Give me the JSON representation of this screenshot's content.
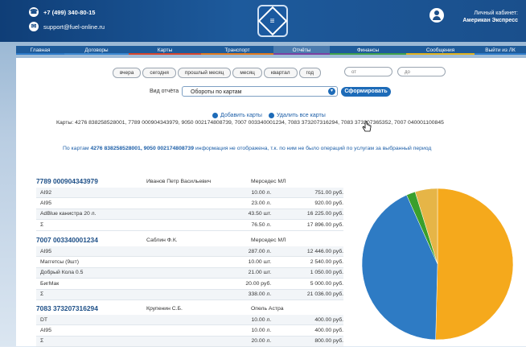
{
  "header": {
    "phone": "+7 (499) 340-80-15",
    "email": "support@fuel-online.ru",
    "logo_glyph": "≡",
    "account_label": "Личный кабинет:",
    "account_name": "Американ Экспресс"
  },
  "nav": {
    "items": [
      {
        "label": "Главная",
        "underline": "#2d7ac8"
      },
      {
        "label": "Договоры",
        "underline": "#3a86cf"
      },
      {
        "label": "Карты",
        "underline": "#d6452d"
      },
      {
        "label": "Транспорт",
        "underline": "#e17a1e"
      },
      {
        "label": "Отчёты",
        "underline": "#7a3fa0",
        "active": true
      },
      {
        "label": "Финансы",
        "underline": "#3fa04a"
      },
      {
        "label": "Сообщения",
        "underline": "#e0b21e"
      },
      {
        "label": "Выйти из ЛК",
        "underline": "#2d7ac8"
      }
    ]
  },
  "period_buttons": [
    "вчера",
    "сегодня",
    "прошлый месяц",
    "месяц",
    "квартал",
    "год"
  ],
  "date_from_placeholder": "от",
  "date_to_placeholder": "до",
  "report_type_label": "Вид отчёта",
  "report_type_value": "Обороты по картам",
  "generate_button": "Сформировать",
  "add_cards_link": "Добавить карты",
  "remove_cards_link": "Удалить все карты",
  "cards_line": "Карты: 4276 838258528001, 7789 000904343979, 9050 002174808739, 7007 003340001234, 7083 373207316294, 7083 373207365352, 7007 040001100845",
  "info": {
    "prefix": "По картам",
    "cards": "4276 838258528001, 9050 002174808739",
    "suffix": "информация не отображена, т.к. по ним не было операций по услугам за выбранный период"
  },
  "groups": [
    {
      "card": "7789 000904343979",
      "owner": "Иванов Петр Васильевич",
      "car": "Мерседес МЛ",
      "rows": [
        {
          "item": "AI92",
          "qty": "10.00 л.",
          "amount": "751.00 руб."
        },
        {
          "item": "AI95",
          "qty": "23.00 л.",
          "amount": "920.00 руб."
        },
        {
          "item": "AdBlue канистра 20 л.",
          "qty": "43.50 шт.",
          "amount": "16 225.00 руб."
        },
        {
          "item": "Σ",
          "qty": "76.50 л.",
          "amount": "17 896.00 руб."
        }
      ]
    },
    {
      "card": "7007 003340001234",
      "owner": "Саблин Ф.К.",
      "car": "Мерседес МЛ",
      "rows": [
        {
          "item": "AI95",
          "qty": "287.00 л.",
          "amount": "12 446.00 руб."
        },
        {
          "item": "Маггетсы (9шт)",
          "qty": "10.00 шт.",
          "amount": "2 540.00 руб."
        },
        {
          "item": "Добрый Кола 0.5",
          "qty": "21.00 шт.",
          "amount": "1 050.00 руб."
        },
        {
          "item": "БигМак",
          "qty": "20.00 руб.",
          "amount": "5 000.00 руб."
        },
        {
          "item": "Σ",
          "qty": "338.00 л.",
          "amount": "21 036.00 руб."
        }
      ]
    },
    {
      "card": "7083 373207316294",
      "owner": "Крупенин С.Б.",
      "car": "Опель Астра",
      "rows": [
        {
          "item": "DT",
          "qty": "10.00 л.",
          "amount": "400.00 руб."
        },
        {
          "item": "AI95",
          "qty": "10.00 л.",
          "amount": "400.00 руб."
        },
        {
          "item": "Σ",
          "qty": "20.00 л.",
          "amount": "800.00 руб."
        }
      ]
    }
  ],
  "chart_data": {
    "type": "pie",
    "values": [
      17896,
      21036,
      800,
      2000
    ],
    "colors": [
      "#2e7bc4",
      "#f5a91c",
      "#3a9f2c",
      "#e6b547"
    ]
  }
}
